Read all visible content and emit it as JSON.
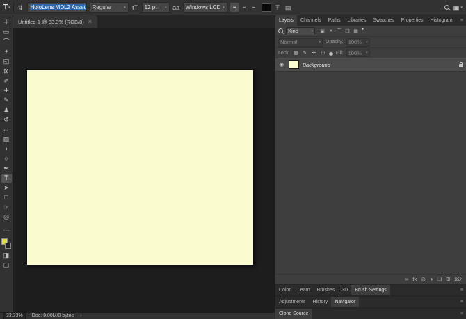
{
  "theme": {
    "selection_blue": "#2e66ab",
    "document_color": "#fbfbd0",
    "foreground_color": "#dcdc4a"
  },
  "options_bar": {
    "tool_badge": "T",
    "tool_caret": "▾",
    "orientation_icon": "⇅",
    "font_family": "HoloLens MDL2 Asset",
    "font_style": "Regular",
    "size_icon": "tT",
    "font_size": "12 pt",
    "anti_alias_icon": "aa",
    "anti_alias": "Windows LCD",
    "align_left_icon": "≡",
    "align_center_icon": "≡",
    "align_right_icon": "≡",
    "warp_icon": "Ŧ",
    "panels_icon": "▤",
    "workspace_icon": "▣",
    "combo_caret": "▾"
  },
  "document_tab": {
    "title": "Untitled-1 @ 33.3% (RGB/8)",
    "close_icon": "×"
  },
  "toolbar": {
    "tools": [
      {
        "name": "Move",
        "glyph": "✛"
      },
      {
        "name": "Rectangular Marquee",
        "glyph": "▭"
      },
      {
        "name": "Lasso",
        "glyph": "⌒"
      },
      {
        "name": "Quick Selection",
        "glyph": "✦"
      },
      {
        "name": "Crop",
        "glyph": "◱"
      },
      {
        "name": "Frame",
        "glyph": "⊠"
      },
      {
        "name": "Eyedropper",
        "glyph": "✐"
      },
      {
        "name": "Spot Healing Brush",
        "glyph": "✚"
      },
      {
        "name": "Brush",
        "glyph": "✎"
      },
      {
        "name": "Clone Stamp",
        "glyph": "♟"
      },
      {
        "name": "History Brush",
        "glyph": "↺"
      },
      {
        "name": "Eraser",
        "glyph": "▱"
      },
      {
        "name": "Gradient",
        "glyph": "▨"
      },
      {
        "name": "Blur",
        "glyph": "◗"
      },
      {
        "name": "Dodge",
        "glyph": "○"
      },
      {
        "name": "Pen",
        "glyph": "✒"
      },
      {
        "name": "Horizontal Type",
        "glyph": "T"
      },
      {
        "name": "Path Selection",
        "glyph": "➤"
      },
      {
        "name": "Rectangle",
        "glyph": "□"
      },
      {
        "name": "Hand",
        "glyph": "☞"
      },
      {
        "name": "Zoom",
        "glyph": "◎"
      }
    ],
    "edit_toolbar_icon": "⋯",
    "quick_mask_icon": "◨",
    "screen_mode_icon": "▢"
  },
  "panels": {
    "dock_tabs": [
      "Layers",
      "Channels",
      "Paths",
      "Libraries",
      "Swatches",
      "Properties",
      "Histogram"
    ],
    "panel_menu_icon": "≡",
    "layers": {
      "filter_label": "Kind",
      "filter_icons": [
        "▣",
        "◑",
        "T",
        "❏",
        "▦"
      ],
      "filter_toggle_icon": "●",
      "blend_mode": "Normal",
      "opacity_label": "Opacity:",
      "opacity_value": "100%",
      "lock_label": "Lock:",
      "lock_icons": [
        "▦",
        "✎",
        "✛",
        "⊡"
      ],
      "fill_label": "Fill:",
      "fill_value": "100%",
      "layer": {
        "name": "Background",
        "eye_icon": "◉"
      },
      "footer_icons": [
        "∞",
        "fx",
        "◎",
        "◑",
        "❏",
        "⊞",
        "⌦"
      ]
    },
    "group1_tabs": [
      "Color",
      "Learn",
      "Brushes",
      "3D",
      "Brush Settings"
    ],
    "group2_tabs": [
      "Adjustments",
      "History",
      "Navigator"
    ],
    "group3_tabs": [
      "Clone Source"
    ]
  },
  "status_bar": {
    "zoom": "33.33%",
    "doc_info": "Doc: 9.00M/0 bytes",
    "expand_icon": "›"
  }
}
